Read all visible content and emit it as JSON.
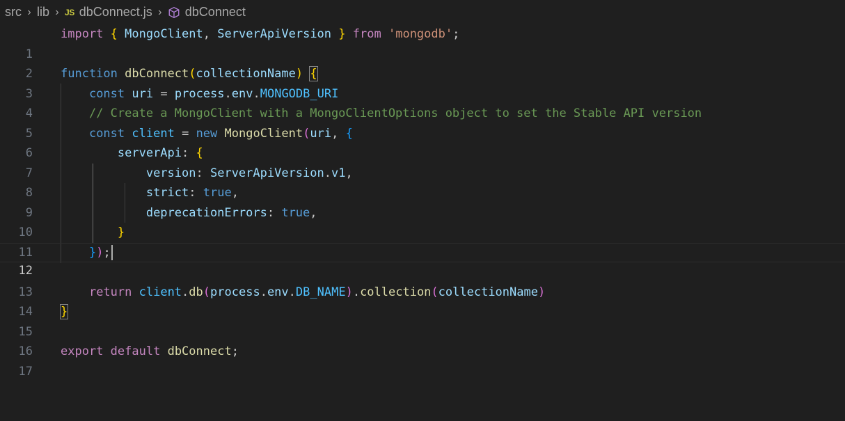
{
  "breadcrumb": {
    "items": [
      "src",
      "lib",
      "dbConnect.js",
      "dbConnect"
    ],
    "file_badge": "JS",
    "icons": [
      "chevron-right-icon",
      "js-file-icon",
      "cube-symbol-icon"
    ]
  },
  "editor": {
    "current_line": 12,
    "line_numbers": [
      "1",
      "2",
      "3",
      "4",
      "5",
      "6",
      "7",
      "8",
      "9",
      "10",
      "11",
      "12",
      "13",
      "14",
      "15",
      "16",
      "17"
    ],
    "t": {
      "import": "import",
      "lbrace": "{",
      "rbrace": "}",
      "MongoClient": "MongoClient",
      "ServerApiVersion": "ServerApiVersion",
      "from": "from",
      "mongodb": "'mongodb'",
      "function": "function",
      "dbConnect": "dbConnect",
      "collectionName": "collectionName",
      "const": "const",
      "uri": "uri",
      "process": "process",
      "env": "env",
      "MONGODB_URI": "MONGODB_URI",
      "comment": "// Create a MongoClient with a MongoClientOptions object to set the Stable API version",
      "client": "client",
      "new": "new",
      "serverApi": "serverApi",
      "version": "version",
      "v1": "v1",
      "strict": "strict",
      "true": "true",
      "deprecationErrors": "deprecationErrors",
      "return": "return",
      "db": "db",
      "DB_NAME": "DB_NAME",
      "collection": "collection",
      "export": "export",
      "default": "default"
    }
  },
  "colors": {
    "background": "#1f1f1f",
    "keyword_control": "#c586c0",
    "keyword_storage": "#569cd6",
    "function": "#dcdcaa",
    "variable": "#9cdcfe",
    "constant": "#4fc1ff",
    "string": "#ce9178",
    "comment": "#6a9955"
  }
}
